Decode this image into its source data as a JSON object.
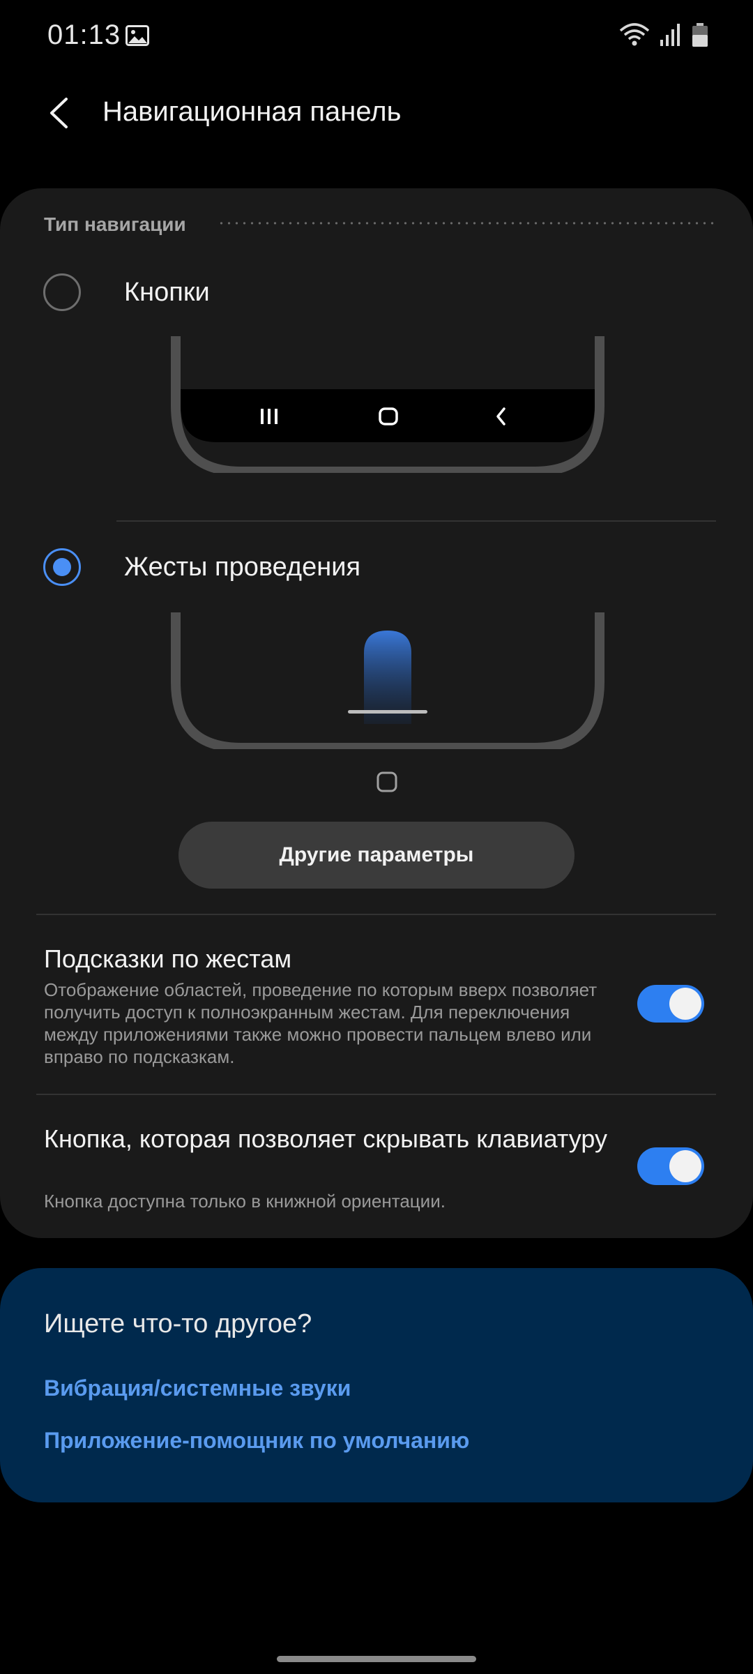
{
  "status": {
    "time": "01:13",
    "icons": [
      "gallery-icon",
      "wifi-icon",
      "signal-icon",
      "battery-icon"
    ]
  },
  "header": {
    "title": "Навигационная панель",
    "back_icon": "chevron-left-icon"
  },
  "nav_type": {
    "section_label": "Тип навигации",
    "options": [
      {
        "label": "Кнопки",
        "selected": false
      },
      {
        "label": "Жесты проведения",
        "selected": true
      }
    ],
    "more_button": "Другие параметры"
  },
  "settings": [
    {
      "title": "Подсказки по жестам",
      "description": "Отображение областей, проведение по которым вверх позволяет получить доступ к полноэкранным жестам. Для переключения между приложениями также можно провести пальцем влево или вправо по подсказкам.",
      "enabled": true
    },
    {
      "title": "Кнопка, которая позволяет скрывать клавиатуру",
      "description": "Кнопка доступна только в книжной ориентации.",
      "enabled": true
    }
  ],
  "suggestions": {
    "title": "Ищете что-то другое?",
    "links": [
      "Вибрация/системные звуки",
      "Приложение-помощник по умолчанию"
    ]
  },
  "colors": {
    "accent": "#4a8ff5",
    "toggle_on": "#2d7ff1",
    "card_bg": "#1a1a1a",
    "suggest_bg": "#00294d",
    "link": "#5a9bef"
  }
}
